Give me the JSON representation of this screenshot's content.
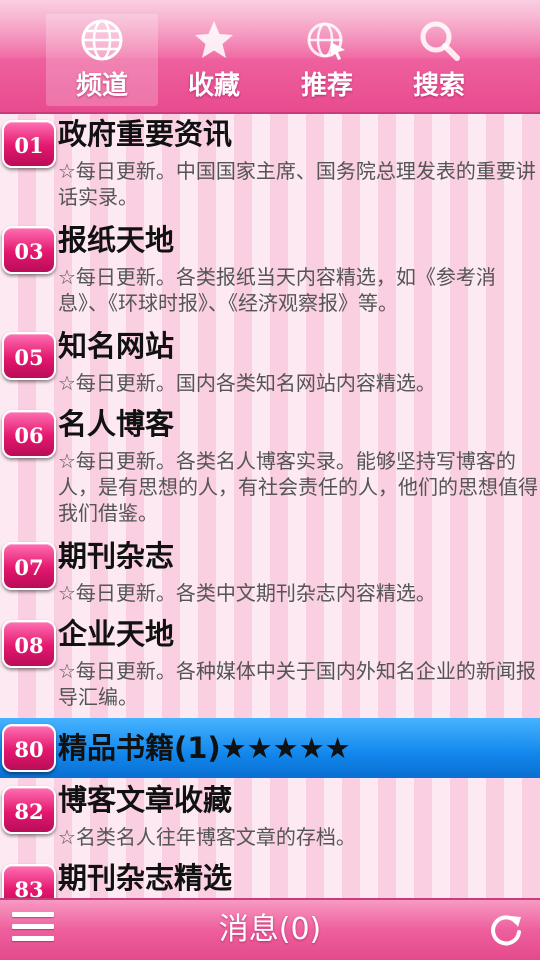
{
  "tabs": [
    {
      "label": "频道",
      "icon": "globe-icon",
      "active": true
    },
    {
      "label": "收藏",
      "icon": "star-icon",
      "active": false
    },
    {
      "label": "推荐",
      "icon": "web-pointer-icon",
      "active": false
    },
    {
      "label": "搜索",
      "icon": "search-icon",
      "active": false
    }
  ],
  "items": [
    {
      "num": "01",
      "title": "政府重要资讯",
      "desc": "☆每日更新。中国国家主席、国务院总理发表的重要讲话实录。"
    },
    {
      "num": "03",
      "title": "报纸天地",
      "desc": "☆每日更新。各类报纸当天内容精选，如《参考消息》、《环球时报》、《经济观察报》等。"
    },
    {
      "num": "05",
      "title": "知名网站",
      "desc": "☆每日更新。国内各类知名网站内容精选。"
    },
    {
      "num": "06",
      "title": "名人博客",
      "desc": "☆每日更新。各类名人博客实录。能够坚持写博客的人，是有思想的人，有社会责任的人，他们的思想值得我们借鉴。"
    },
    {
      "num": "07",
      "title": "期刊杂志",
      "desc": "☆每日更新。各类中文期刊杂志内容精选。"
    },
    {
      "num": "08",
      "title": "企业天地",
      "desc": "☆每日更新。各种媒体中关于国内外知名企业的新闻报导汇编。"
    },
    {
      "num": "80",
      "title": "精品书籍(1)★★★★★",
      "desc": ""
    },
    {
      "num": "82",
      "title": "博客文章收藏",
      "desc": "☆名类名人往年博客文章的存档。"
    },
    {
      "num": "83",
      "title": "期刊杂志精选",
      "desc": ""
    }
  ],
  "bottom": {
    "message_label": "消息(0)"
  },
  "colors": {
    "accent_pink": "#e84b8f",
    "badge_pink": "#e4176f",
    "highlight_blue": "#1287ec"
  }
}
